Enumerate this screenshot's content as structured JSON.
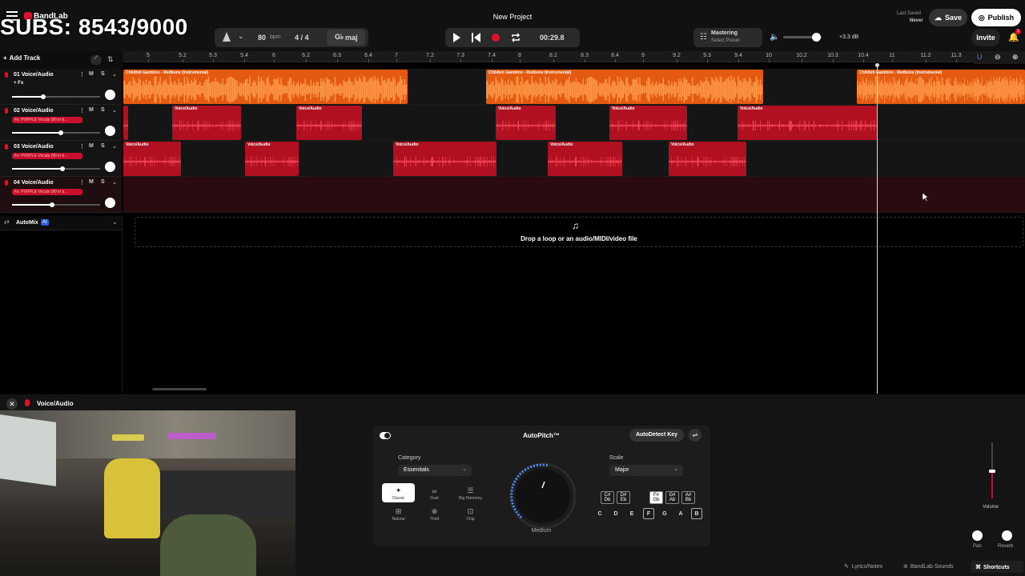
{
  "overlay": {
    "subs": "SUBS: 8543/9000"
  },
  "header": {
    "app_name": "BandLab",
    "project_title": "New Project",
    "bpm_value": "80",
    "bpm_unit": "bpm",
    "time_signature": "4 / 4",
    "key": "maj",
    "time": "00:29.8",
    "mastering_label": "Mastering",
    "mastering_preset": "Select Preset",
    "volume_db": "+3.3 dB",
    "last_saved_label": "Last Saved",
    "last_saved_value": "Never",
    "save_label": "Save",
    "publish_label": "Publish",
    "invite_label": "Invite",
    "notification_count": "1"
  },
  "toolbar": {
    "add_track_label": "Add Track"
  },
  "ruler": {
    "ticks": [
      "5",
      "5.2",
      "5.3",
      "5.4",
      "6",
      "6.2",
      "6.3",
      "6.4",
      "7",
      "7.2",
      "7.3",
      "7.4",
      "8",
      "8.2",
      "8.3",
      "8.4",
      "9",
      "9.2",
      "9.3",
      "9.4",
      "10",
      "10.2",
      "10.3",
      "10.4",
      "11",
      "11.2",
      "11.3"
    ]
  },
  "tracks": [
    {
      "name": "01 Voice/Audio",
      "fx": "+ Fx",
      "mute": "M",
      "solo": "S",
      "volume_fraction": 0.35
    },
    {
      "name": "02 Voice/Audio",
      "fx": "Fx: PVRPLE Vocals (90 in b...",
      "mute": "M",
      "solo": "S",
      "volume_fraction": 0.55
    },
    {
      "name": "03 Voice/Audio",
      "fx": "Fx: PVRPLE Vocals (90 in b...",
      "mute": "M",
      "solo": "S",
      "volume_fraction": 0.57
    },
    {
      "name": "04 Voice/Audio",
      "fx": "Fx: PVRPLE Vocals (90 in b...",
      "mute": "M",
      "solo": "S",
      "volume_fraction": 0.45
    }
  ],
  "clips": {
    "orange_title": "Childish Gambino - Redbone (Instrumental)",
    "red_title": "Voice/Audio"
  },
  "automix": {
    "label": "AutoMix",
    "badge": "AI"
  },
  "dropzone": {
    "text": "Drop a loop or an audio/MIDI/video file"
  },
  "editor": {
    "track_label": "Voice/Audio",
    "title": "AutoPitch™",
    "autodetect_label": "AutoDetect Key",
    "category_label": "Category",
    "category_value": "Essentials",
    "styles": [
      "Classic",
      "Duet",
      "Big Harmony",
      "Natural",
      "Third",
      "Chip"
    ],
    "knob_value": "Medium",
    "scale_label": "Scale",
    "scale_value": "Major",
    "sharp_keys": [
      [
        "C#",
        "Db"
      ],
      [
        "D#",
        "Eb"
      ],
      [
        "F#",
        "Gb"
      ],
      [
        "G#",
        "Ab"
      ],
      [
        "A#",
        "Bb"
      ]
    ],
    "notes": [
      "C",
      "D",
      "E",
      "F",
      "G",
      "A",
      "B"
    ],
    "selected_notes": [
      "F",
      "B"
    ],
    "volume_label": "Volume",
    "pan_label": "Pan",
    "reverb_label": "Reverb"
  },
  "footer": {
    "lyrics_label": "Lyrics/Notes",
    "sounds_label": "BandLab Sounds",
    "shortcuts_label": "Shortcuts"
  },
  "colors": {
    "accent_red": "#c8102e",
    "clip_orange": "#e35a10",
    "clip_red": "#b01020",
    "bg": "#000000"
  }
}
